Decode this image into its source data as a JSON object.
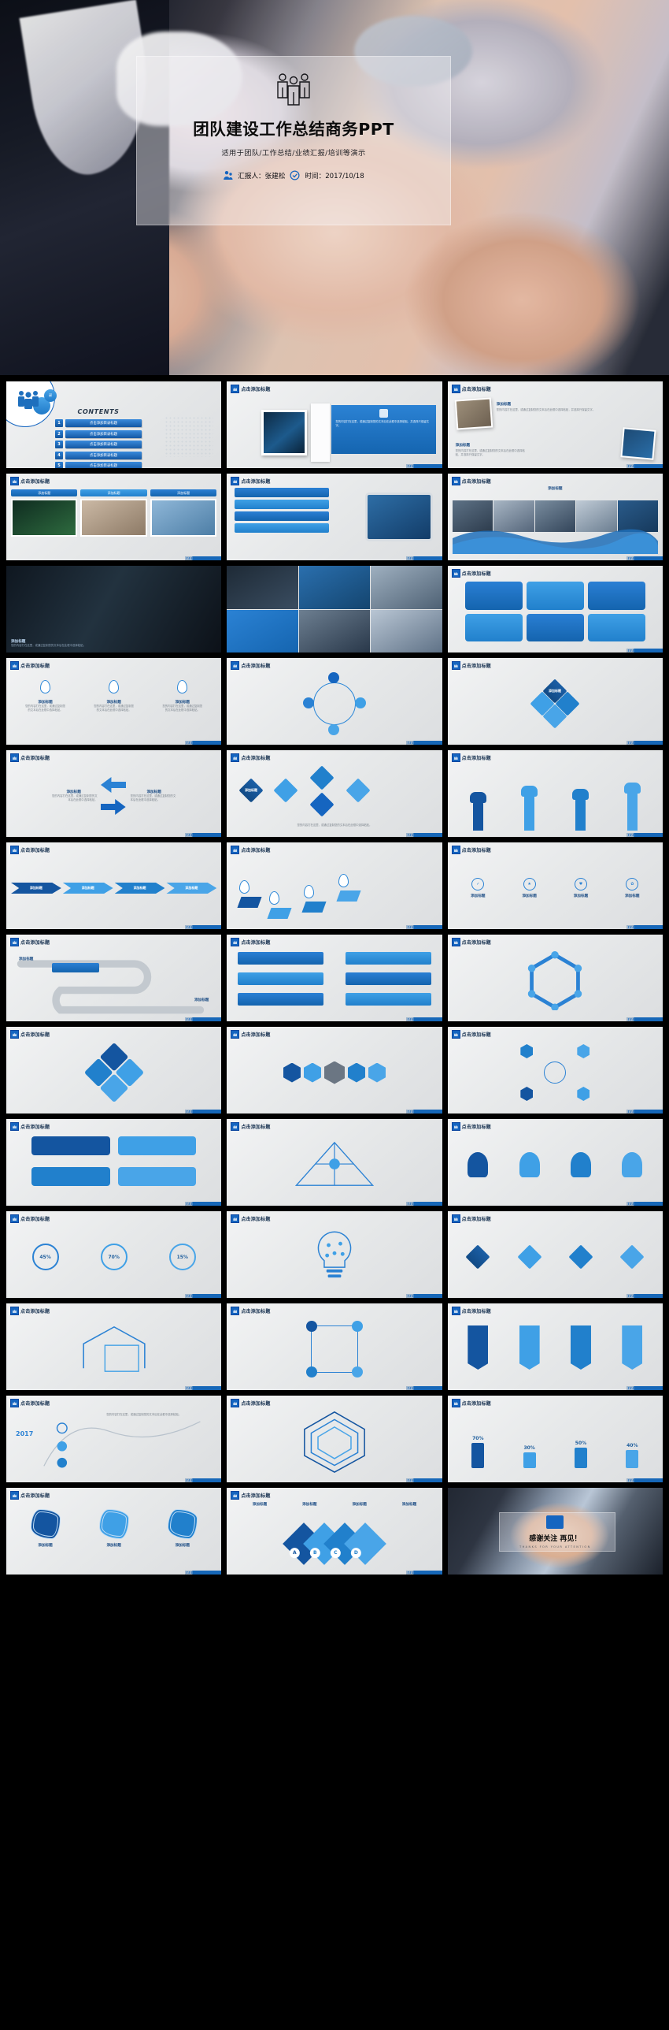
{
  "cover": {
    "title": "团队建设工作总结商务PPT",
    "subtitle": "适用于团队/工作总结/业绩汇报/培训等演示",
    "presenter_label": "汇报人：张建松",
    "date_label": "时间：2017/10/18",
    "presenter_icon": "people-icon",
    "date_icon": "clock-check-icon",
    "team_icon": "team-group-icon"
  },
  "colors": {
    "primary": "#1565c0",
    "primary_dark": "#0d47a1",
    "accent_light": "#3fa0e6",
    "accent_mid": "#2180cc",
    "slide_bg": "#ebedee",
    "page_bg": "#000000",
    "title_text": "#16304f"
  },
  "common": {
    "slide_header": "点击添加标题",
    "add_title": "添加标题",
    "contents_heading": "CONTENTS",
    "contents_item": "点击添加目录标题",
    "body_placeholder": "您的内容打在这里，或通过复制您的文本后在此框中选择粘贴，并选择只保留文字。",
    "body_placeholder_short": "您的内容打在这里，或通过复制您的文本后在此框中选择粘贴。"
  },
  "contents": {
    "heading": "CONTENTS",
    "items": [
      {
        "num": "1",
        "label": "点击添加目录标题"
      },
      {
        "num": "2",
        "label": "点击添加目录标题"
      },
      {
        "num": "3",
        "label": "点击添加目录标题"
      },
      {
        "num": "4",
        "label": "点击添加目录标题"
      },
      {
        "num": "5",
        "label": "点击添加目录标题"
      }
    ]
  },
  "closing": {
    "thanks": "感谢关注 再见！",
    "thanks_en": "THANKS FOR YOUR ATTENTION",
    "icon": "handshake-icon"
  },
  "stat_values": [
    "45%",
    "70%",
    "15%"
  ],
  "bar_values": [
    "70%",
    "30%",
    "50%",
    "40%"
  ],
  "letters": [
    "A",
    "B",
    "C",
    "D"
  ],
  "year": "2017",
  "slides": [
    {
      "id": 1,
      "kind": "contents",
      "header": "点击添加标题"
    },
    {
      "id": 2,
      "kind": "img-text",
      "header": "点击添加标题"
    },
    {
      "id": 3,
      "kind": "polaroids",
      "header": "点击添加标题"
    },
    {
      "id": 4,
      "kind": "three-cards",
      "header": "点击添加标题"
    },
    {
      "id": 5,
      "kind": "device",
      "header": "点击添加标题"
    },
    {
      "id": 6,
      "kind": "wave-photos",
      "header": "点击添加标题"
    },
    {
      "id": 7,
      "kind": "photo-dark",
      "header": "点击添加标题"
    },
    {
      "id": 8,
      "kind": "photo-grid",
      "header": "点击添加标题"
    },
    {
      "id": 9,
      "kind": "rounded-net",
      "header": "点击添加标题"
    },
    {
      "id": 10,
      "kind": "pins-row",
      "header": "点击添加标题"
    },
    {
      "id": 11,
      "kind": "gear-ring",
      "header": "点击添加标题"
    },
    {
      "id": 12,
      "kind": "diamond-4",
      "header": "点击添加标题"
    },
    {
      "id": 13,
      "kind": "arrows-in",
      "header": "点击添加标题"
    },
    {
      "id": 14,
      "kind": "flow-nodes",
      "header": "点击添加标题"
    },
    {
      "id": 15,
      "kind": "hands-up",
      "header": "点击添加标题"
    },
    {
      "id": 16,
      "kind": "chevrons",
      "header": "点击添加标题"
    },
    {
      "id": 17,
      "kind": "cube-steps",
      "header": "点击添加标题"
    },
    {
      "id": 18,
      "kind": "circles-row",
      "header": "点击添加标题"
    },
    {
      "id": 19,
      "kind": "road-map",
      "header": "点击添加标题"
    },
    {
      "id": 20,
      "kind": "tree-flow",
      "header": "点击添加标题"
    },
    {
      "id": 21,
      "kind": "hex-ring",
      "header": "点击添加标题"
    },
    {
      "id": 22,
      "kind": "puzzle-4",
      "header": "点击添加标题"
    },
    {
      "id": 23,
      "kind": "hex-chain",
      "header": "点击添加标题"
    },
    {
      "id": 24,
      "kind": "globe-hex",
      "header": "点击添加标题"
    },
    {
      "id": 25,
      "kind": "badge-4",
      "header": "点击添加标题"
    },
    {
      "id": 26,
      "kind": "triangle-3",
      "header": "点击添加标题"
    },
    {
      "id": 27,
      "kind": "bulb-heads",
      "header": "点击添加标题"
    },
    {
      "id": 28,
      "kind": "rings-3",
      "header": "点击添加标题"
    },
    {
      "id": 29,
      "kind": "bulb-net",
      "header": "点击添加标题"
    },
    {
      "id": 30,
      "kind": "diamond-row",
      "header": "点击添加标题"
    },
    {
      "id": 31,
      "kind": "arrow-box",
      "header": "点击添加标题"
    },
    {
      "id": 32,
      "kind": "square-net",
      "header": "点击添加标题"
    },
    {
      "id": 33,
      "kind": "ribbons",
      "header": "点击添加标题"
    },
    {
      "id": 34,
      "kind": "timeline",
      "header": "点击添加标题"
    },
    {
      "id": 35,
      "kind": "hex-nest",
      "header": "点击添加标题"
    },
    {
      "id": 36,
      "kind": "bar-stats",
      "header": "点击添加标题"
    },
    {
      "id": 37,
      "kind": "flower-3",
      "header": "点击添加标题"
    },
    {
      "id": 38,
      "kind": "puzzle-abcd",
      "header": "点击添加标题"
    },
    {
      "id": 39,
      "kind": "closing",
      "header": ""
    }
  ]
}
